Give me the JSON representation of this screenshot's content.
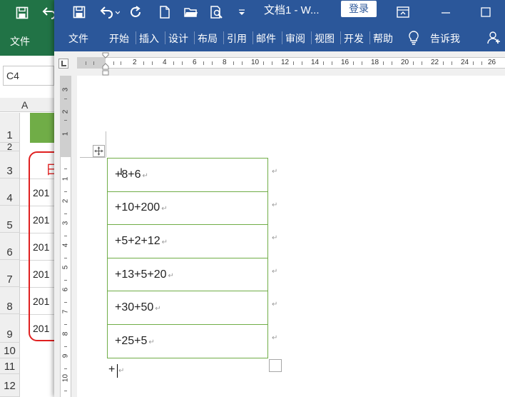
{
  "excel": {
    "ribbon_tab": "文件",
    "name_box": "C4",
    "column_header": "A",
    "row_numbers": [
      "1",
      "2",
      "3",
      "4",
      "5",
      "6",
      "7",
      "8",
      "9",
      "10",
      "11",
      "12"
    ],
    "cells": [
      "201",
      "201",
      "201",
      "201",
      "201",
      "201"
    ],
    "header_char": "日",
    "colors": {
      "ribbon": "#217346",
      "header_fill": "#70ad47",
      "highlight_border": "#e02020"
    }
  },
  "word": {
    "title": "文档1 - W...",
    "login": "登录",
    "quick_access_icons": [
      "save-icon",
      "undo-icon",
      "redo-icon",
      "new-document-icon",
      "open-folder-icon",
      "print-preview-icon",
      "customize-dropdown-icon"
    ],
    "tabs": [
      "文件",
      "开始",
      "插入",
      "设计",
      "布局",
      "引用",
      "邮件",
      "审阅",
      "视图",
      "开发",
      "帮助"
    ],
    "tell_me": "告诉我",
    "ruler_numbers": [
      "2",
      "4",
      "6",
      "8",
      "10",
      "12",
      "14",
      "16",
      "18",
      "20",
      "22",
      "24",
      "26"
    ],
    "vruler_top_numbers": [
      "3",
      "2",
      "1"
    ],
    "vruler_numbers": [
      "1",
      "2",
      "3",
      "4",
      "5",
      "6",
      "7",
      "8",
      "9",
      "10"
    ],
    "table_rows": [
      "+8+6",
      "+10+200",
      "+5+2+12",
      "+13+5+20",
      "+30+50",
      "+25+5"
    ],
    "after_table": "+",
    "paragraph_mark": "↵",
    "colors": {
      "title_bar": "#2b579a",
      "table_border": "#70ad47"
    }
  }
}
